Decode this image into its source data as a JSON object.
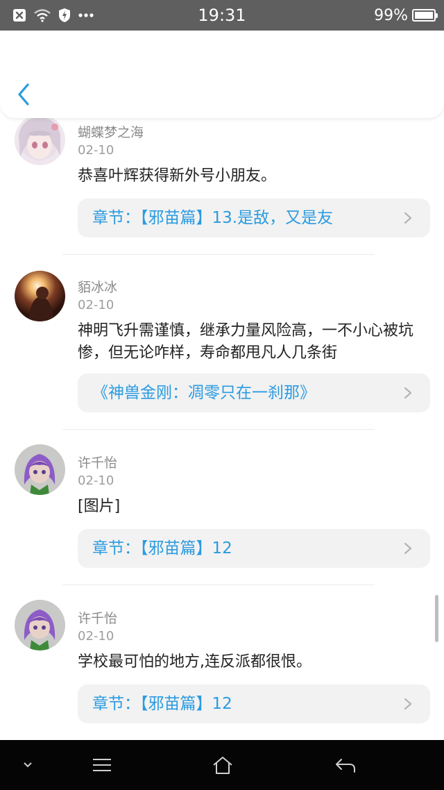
{
  "status_bar": {
    "time": "19:31",
    "battery_text": "99%",
    "battery_level": 0.99,
    "icons": [
      "close-box-icon",
      "wifi-icon",
      "shield-bolt-icon",
      "more-dots-icon"
    ]
  },
  "header": {
    "back_icon": "chevron-left-icon"
  },
  "colors": {
    "accent": "#2a9be0",
    "card_bg": "#f2f2f2",
    "status_bar": "#5f5f5f",
    "nav_bar": "#050505"
  },
  "comments": [
    {
      "username": "蝴蝶梦之海",
      "date": "02-10",
      "content": "恭喜叶辉获得新外号小朋友。",
      "link": "章节：【邪苗篇】13.是敌，又是友",
      "avatar": "anime-girl-avatar"
    },
    {
      "username": "貊冰冰",
      "date": "02-10",
      "content": "神明飞升需谨慎，继承力量风险高，一不小心被坑惨，但无论咋样，寿命都甩凡人几条街",
      "link": "《神兽金刚：凋零只在一刹那》",
      "avatar": "sunset-photo-avatar"
    },
    {
      "username": "许千怡",
      "date": "02-10",
      "content": "[图片]",
      "link": "章节：【邪苗篇】12",
      "avatar": "purple-hair-avatar"
    },
    {
      "username": "许千怡",
      "date": "02-10",
      "content": "学校最可怕的地方,连反派都很恨。",
      "link": "章节：【邪苗篇】12",
      "avatar": "purple-hair-avatar"
    }
  ],
  "nav_bar": {
    "buttons": [
      "chevron-down-icon",
      "menu-icon",
      "home-icon",
      "back-arrow-icon"
    ]
  }
}
